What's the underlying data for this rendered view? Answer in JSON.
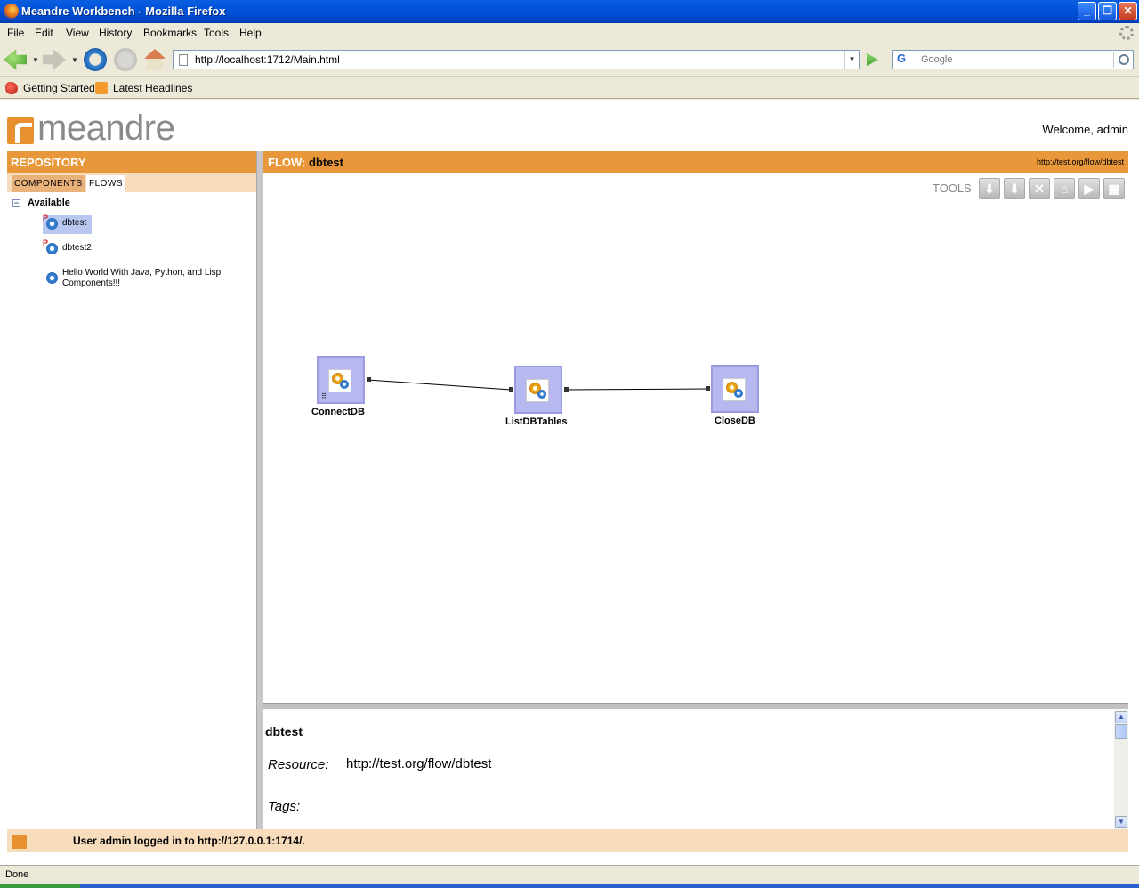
{
  "window": {
    "title": "Meandre Workbench - Mozilla Firefox",
    "minimize": "_",
    "maximize": "❐",
    "close": "✕"
  },
  "menu": [
    "File",
    "Edit",
    "View",
    "History",
    "Bookmarks",
    "Tools",
    "Help"
  ],
  "nav": {
    "url": "http://localhost:1712/Main.html",
    "search_placeholder": "Google",
    "search_engine": "G"
  },
  "bookmarks": [
    "Getting Started",
    "Latest Headlines"
  ],
  "app": {
    "logo_text": "meandre",
    "welcome": "Welcome, admin",
    "repository": {
      "title": "REPOSITORY",
      "tabs": [
        "COMPONENTS",
        "FLOWS"
      ],
      "active_tab": "COMPONENTS",
      "tree_root": "Available",
      "expander": "−",
      "items": [
        {
          "label": "dbtest",
          "flag": "P",
          "selected": true
        },
        {
          "label": "dbtest2",
          "flag": "P",
          "selected": false
        },
        {
          "label": "Hello World With Java, Python, and Lisp Components!!!",
          "flag": "",
          "selected": false
        }
      ]
    },
    "flow": {
      "prefix": "FLOW:",
      "name": "dbtest",
      "uri": "http://test.org/flow/dbtest",
      "tools_label": "TOOLS",
      "tools": [
        {
          "icon": "save-icon",
          "glyph": "⬇"
        },
        {
          "icon": "save-as-icon",
          "glyph": "⬇"
        },
        {
          "icon": "delete-icon",
          "glyph": "✕"
        },
        {
          "icon": "new-icon",
          "glyph": "⌂"
        },
        {
          "icon": "run-icon",
          "glyph": "▶"
        },
        {
          "icon": "layout-icon",
          "glyph": "▦"
        }
      ],
      "nodes": [
        {
          "label": "ConnectDB"
        },
        {
          "label": "ListDBTables"
        },
        {
          "label": "CloseDB"
        }
      ]
    },
    "details": {
      "title": "dbtest",
      "resource_label": "Resource:",
      "resource_value": "http://test.org/flow/dbtest",
      "tags_label": "Tags:"
    },
    "status_message": "User admin logged in to http://127.0.0.1:1714/."
  },
  "browser_status": "Done"
}
